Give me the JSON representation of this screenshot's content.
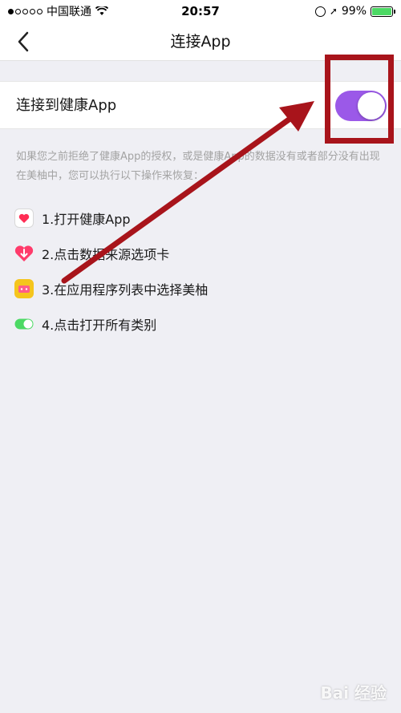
{
  "status_bar": {
    "carrier": "中国联通",
    "time": "20:57",
    "battery": "99%",
    "battery_level": 0.99
  },
  "nav": {
    "title": "连接App"
  },
  "toggle_row": {
    "label": "连接到健康App",
    "enabled": true,
    "accent_color": "#9b59e8"
  },
  "help_text": "如果您之前拒绝了健康App的授权，或是健康App的数据没有或者部分没有出现在美柚中，您可以执行以下操作来恢复：",
  "steps": [
    {
      "label": "1.打开健康App",
      "icon": "health-app-icon"
    },
    {
      "label": "2.点击数据来源选项卡",
      "icon": "data-source-icon"
    },
    {
      "label": "3.在应用程序列表中选择美柚",
      "icon": "meiyou-app-icon"
    },
    {
      "label": "4.点击打开所有类别",
      "icon": "toggle-switch-icon"
    }
  ],
  "annotation": {
    "highlight_color": "#a8141b"
  },
  "watermark": "Bai 经验"
}
